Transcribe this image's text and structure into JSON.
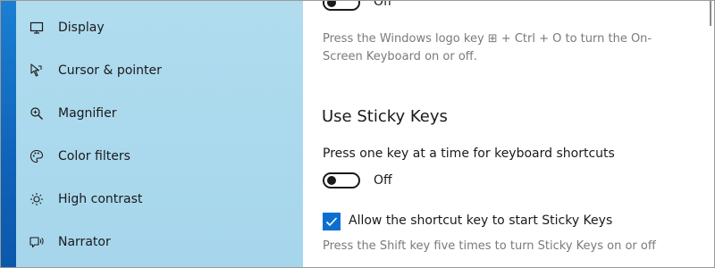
{
  "sidebar": {
    "items": [
      {
        "label": "Display",
        "icon": "monitor-icon"
      },
      {
        "label": "Cursor & pointer",
        "icon": "cursor-icon"
      },
      {
        "label": "Magnifier",
        "icon": "magnifier-icon"
      },
      {
        "label": "Color filters",
        "icon": "color-palette-icon"
      },
      {
        "label": "High contrast",
        "icon": "high-contrast-icon"
      },
      {
        "label": "Narrator",
        "icon": "narrator-icon"
      }
    ]
  },
  "content": {
    "on_screen_keyboard": {
      "toggle_state": "Off",
      "description": "Press the Windows logo key ⊞ + Ctrl + O to turn the On-Screen Keyboard on or off."
    },
    "sticky_keys": {
      "heading": "Use Sticky Keys",
      "toggle_description": "Press one key at a time for keyboard shortcuts",
      "toggle_state": "Off",
      "checkbox_label": "Allow the shortcut key to start Sticky Keys",
      "checkbox_checked": true,
      "checkbox_description": "Press the Shift key five times to turn Sticky Keys on or off"
    }
  },
  "colors": {
    "sidebar_bg": "#a9d8ed",
    "accent": "#0c6fcf",
    "muted_text": "#7a7a7a"
  }
}
